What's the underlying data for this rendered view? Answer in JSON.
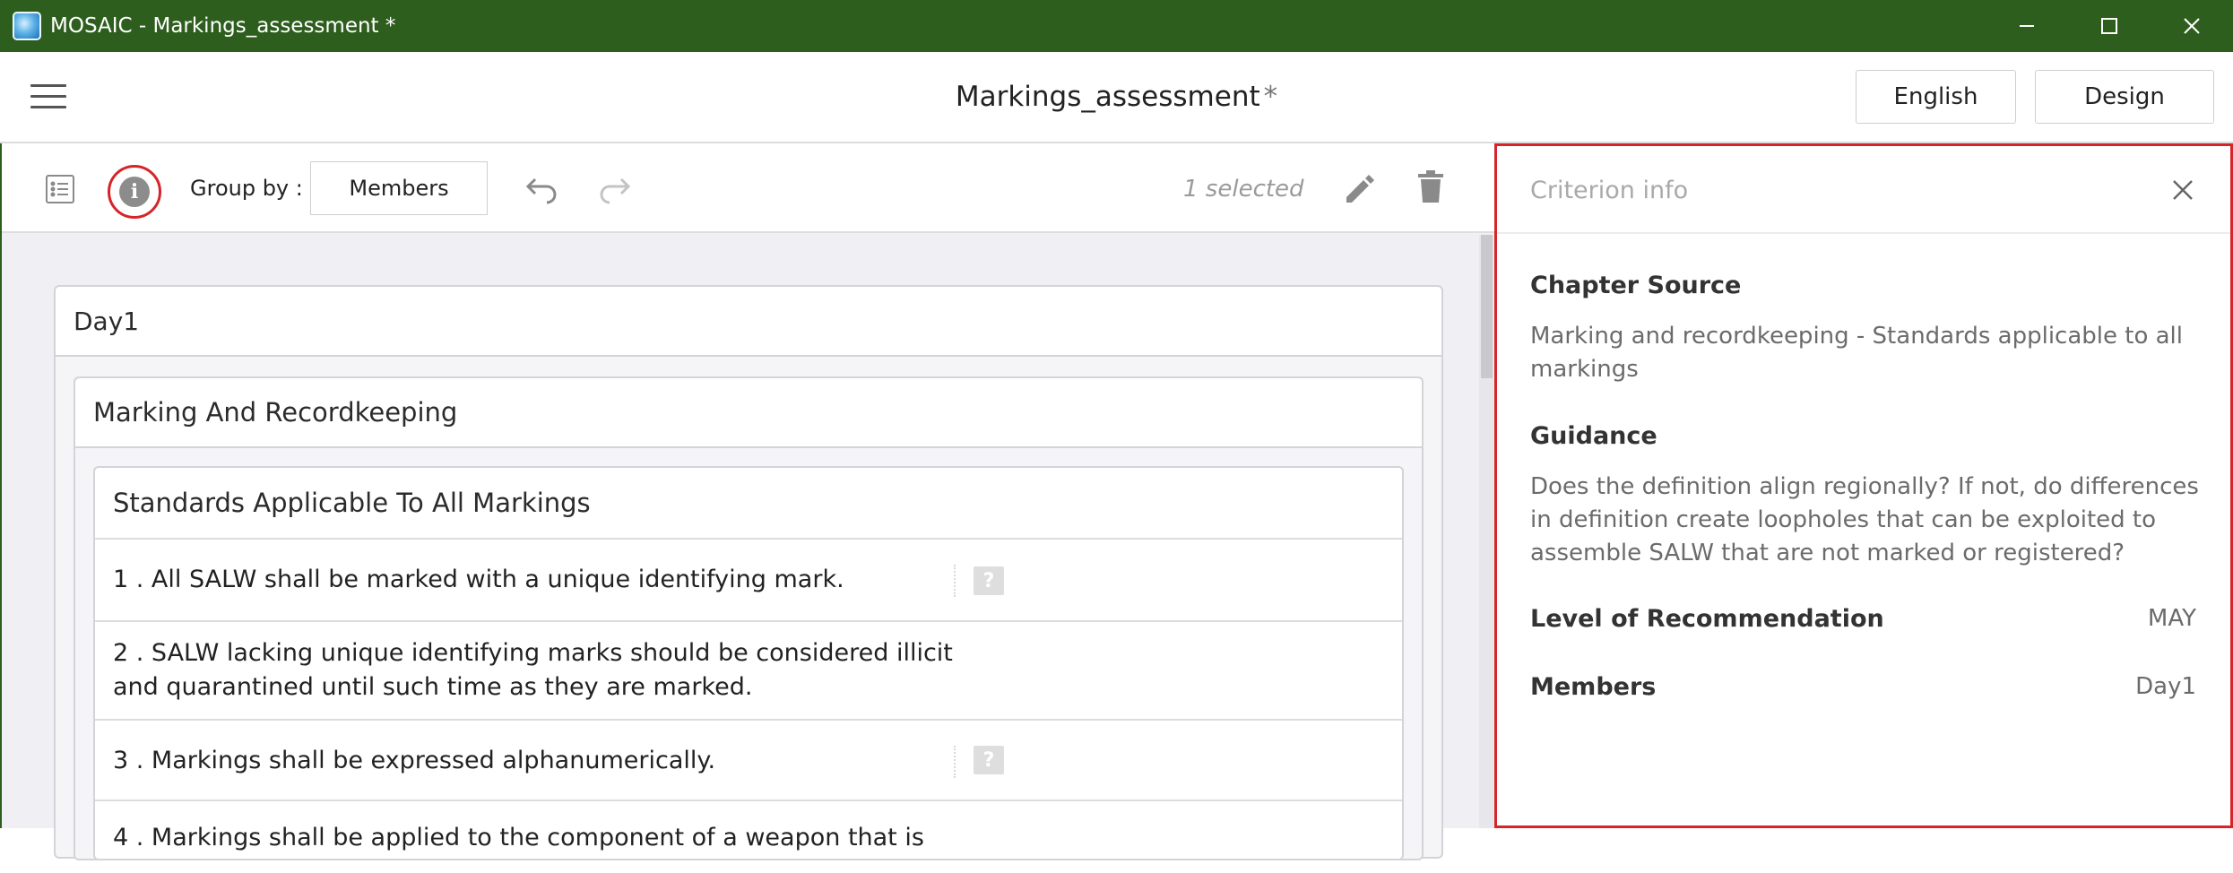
{
  "window": {
    "title": "MOSAIC - Markings_assessment *"
  },
  "header": {
    "doc_title": "Markings_assessment",
    "modified_marker": "*",
    "language_button": "English",
    "mode_button": "Design"
  },
  "toolbar": {
    "group_by_label": "Group by :",
    "group_by_value": "Members",
    "selected_count": "1 selected"
  },
  "tree": {
    "day_title": "Day1",
    "chapter_title": "Marking And Recordkeeping",
    "standard_title": "Standards Applicable To All Markings",
    "criteria": [
      {
        "text": "1 .  All SALW shall be marked with a unique identifying mark.",
        "has_help": true
      },
      {
        "text": "2 .  SALW lacking unique identifying marks should be considered illicit and quarantined until such time as they are marked.",
        "has_help": false
      },
      {
        "text": "3 .  Markings shall be expressed alphanumerically.",
        "has_help": true
      },
      {
        "text": "4 .  Markings shall be applied to the component of a weapon that is",
        "has_help": false
      }
    ],
    "help_glyph": "?"
  },
  "criterion_info": {
    "title": "Criterion info",
    "chapter_source_label": "Chapter Source",
    "chapter_source_text": "Marking and recordkeeping - Standards applicable to all markings",
    "guidance_label": "Guidance",
    "guidance_text": "Does the definition align regionally? If not, do differences in definition create loopholes that can be exploited to assemble SALW that are not marked or registered?",
    "level_label": "Level of Recommendation",
    "level_value": "MAY",
    "members_label": "Members",
    "members_value": "Day1"
  },
  "colors": {
    "titlebar": "#2e5e1e",
    "highlight": "#d6242b",
    "panel_background": "#f0eff4"
  },
  "icons": [
    "app-icon",
    "minimize-icon",
    "maximize-icon",
    "close-icon",
    "hamburger-icon",
    "list-icon",
    "info-icon",
    "undo-icon",
    "redo-icon",
    "edit-icon",
    "trash-icon",
    "help-icon"
  ]
}
